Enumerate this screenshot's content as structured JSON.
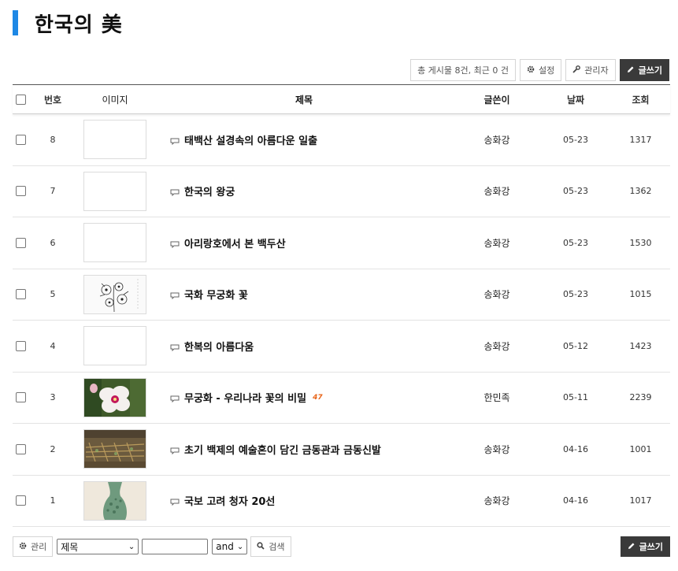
{
  "board": {
    "title": "한국의 美",
    "accent_color": "#1e88e5"
  },
  "toolbar": {
    "total_label": "총 게시물 8건, 최근 0 건",
    "settings_label": "설정",
    "admin_label": "관리자",
    "write_label": "글쓰기"
  },
  "table": {
    "headers": {
      "number": "번호",
      "image": "이미지",
      "subject": "제목",
      "author": "글쓴이",
      "date": "날짜",
      "views": "조회"
    },
    "rows": [
      {
        "num": "8",
        "thumb": "blank",
        "subject": "태백산 설경속의 아름다운 일출",
        "comments": "",
        "author": "송화강",
        "date": "05-23",
        "views": "1317"
      },
      {
        "num": "7",
        "thumb": "blank",
        "subject": "한국의 왕궁",
        "comments": "",
        "author": "송화강",
        "date": "05-23",
        "views": "1362"
      },
      {
        "num": "6",
        "thumb": "blank",
        "subject": "아리랑호에서 본 백두산",
        "comments": "",
        "author": "송화강",
        "date": "05-23",
        "views": "1530"
      },
      {
        "num": "5",
        "thumb": "sketch",
        "subject": "국화 무궁화 꽃",
        "comments": "",
        "author": "송화강",
        "date": "05-23",
        "views": "1015"
      },
      {
        "num": "4",
        "thumb": "blank",
        "subject": "한복의 아름다움",
        "comments": "",
        "author": "송화강",
        "date": "05-12",
        "views": "1423"
      },
      {
        "num": "3",
        "thumb": "flower",
        "subject": "무궁화 - 우리나라 꽃의 비밀",
        "comments": "47",
        "author": "한민족",
        "date": "05-11",
        "views": "2239"
      },
      {
        "num": "2",
        "thumb": "crown",
        "subject": "초기 백제의 예술혼이 담긴 금동관과 금동신발",
        "comments": "",
        "author": "송화강",
        "date": "04-16",
        "views": "1001"
      },
      {
        "num": "1",
        "thumb": "vase",
        "subject": "국보 고려 청자 20선",
        "comments": "",
        "author": "송화강",
        "date": "04-16",
        "views": "1017"
      }
    ]
  },
  "bottom": {
    "manage_label": "관리",
    "search_field_value": "제목",
    "search_input_value": "",
    "operator_value": "and",
    "search_label": "검색",
    "write_label": "글쓰기"
  },
  "icons": {
    "settings": "gear-icon",
    "admin": "wrench-icon",
    "write": "pencil-icon",
    "comment": "speech-bubble-icon",
    "search": "magnifier-icon"
  }
}
